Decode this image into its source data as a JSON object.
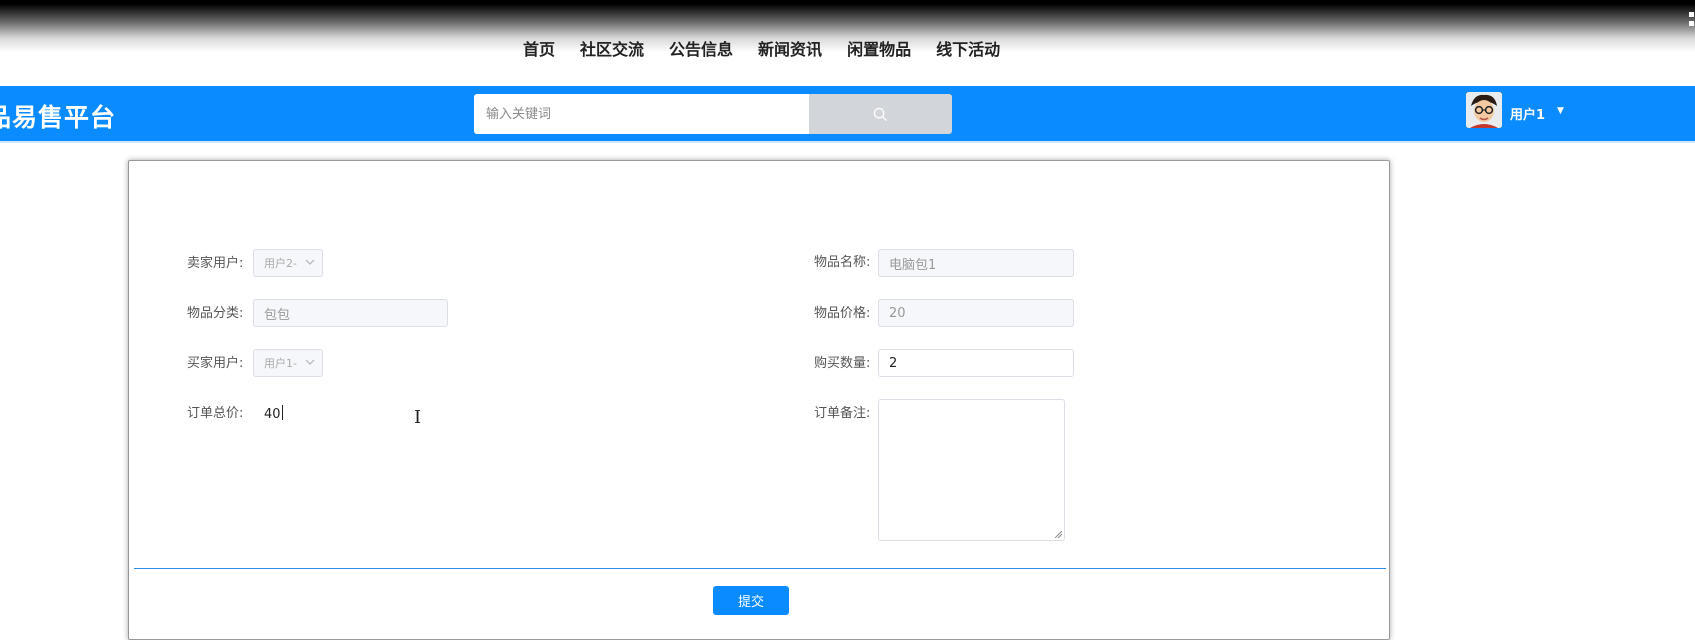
{
  "nav": {
    "items": [
      "首页",
      "社区交流",
      "公告信息",
      "新闻资讯",
      "闲置物品",
      "线下活动"
    ]
  },
  "header": {
    "brand": "品易售平台",
    "search_placeholder": "输入关键词",
    "user_name": "用户1"
  },
  "form": {
    "seller_label": "卖家用户:",
    "seller_value": "用户2-",
    "item_name_label": "物品名称:",
    "item_name_value": "电脑包1",
    "category_label": "物品分类:",
    "category_value": "包包",
    "price_label": "物品价格:",
    "price_value": "20",
    "buyer_label": "买家用户:",
    "buyer_value": "用户1-",
    "quantity_label": "购买数量:",
    "quantity_value": "2",
    "total_label": "订单总价:",
    "total_value": "40",
    "remark_label": "订单备注:",
    "remark_value": "",
    "submit_label": "提交"
  },
  "colors": {
    "header_blue": "#0a8bff",
    "search_button": "#d2d5da",
    "divider": "#2f8fe6"
  },
  "icons": {
    "search": "search-icon",
    "dropdown": "chevron-down-icon",
    "user_menu": "caret-down-icon",
    "resize": "resize-handle-icon",
    "text_cursor": "ibeam-cursor-icon"
  }
}
